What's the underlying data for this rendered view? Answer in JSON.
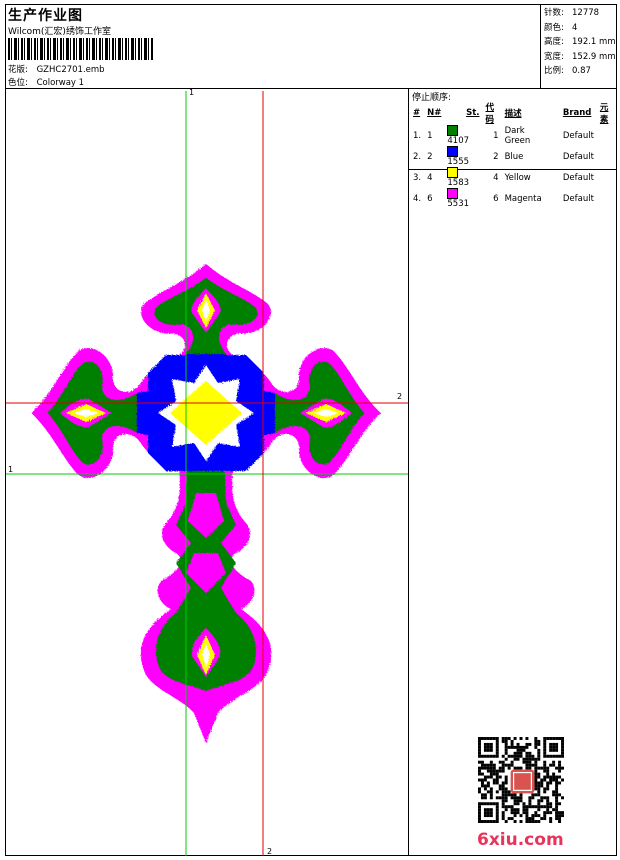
{
  "header": {
    "title": "生产作业图",
    "subtitle": "Wilcom(汇宏)绣饰工作室",
    "pattern_label": "花版:",
    "pattern_value": "GZHC2701.emb",
    "colorway_label": "色位:",
    "colorway_value": "Colorway 1"
  },
  "stats": [
    {
      "label": "针数:",
      "value": "12778"
    },
    {
      "label": "颜色:",
      "value": "4"
    },
    {
      "label": "高度:",
      "value": "192.1 mm"
    },
    {
      "label": "宽度:",
      "value": "152.9 mm"
    },
    {
      "label": "比例:",
      "value": "0.87"
    }
  ],
  "stop_sequence": {
    "title": "停止顺序:",
    "columns": [
      "#",
      "N#",
      "St.",
      "代码",
      "描述",
      "Brand",
      "元素"
    ],
    "rows": [
      {
        "num": "1.",
        "n": "1",
        "color": "#008000",
        "st": "4107",
        "code": "1",
        "desc": "Dark Green",
        "brand": "Default"
      },
      {
        "num": "2.",
        "n": "2",
        "color": "#0000ff",
        "st": "1555",
        "code": "2",
        "desc": "Blue",
        "brand": "Default"
      },
      {
        "num": "3.",
        "n": "4",
        "color": "#ffff00",
        "st": "1583",
        "code": "4",
        "desc": "Yellow",
        "brand": "Default"
      },
      {
        "num": "4.",
        "n": "6",
        "color": "#ff00ff",
        "st": "5531",
        "code": "6",
        "desc": "Magenta",
        "brand": "Default"
      }
    ]
  },
  "guides": {
    "green_label": "1",
    "red_label": "2",
    "green_color": "#00cc00",
    "red_color": "#e00000"
  },
  "watermark": {
    "text": "6xiu.com"
  }
}
